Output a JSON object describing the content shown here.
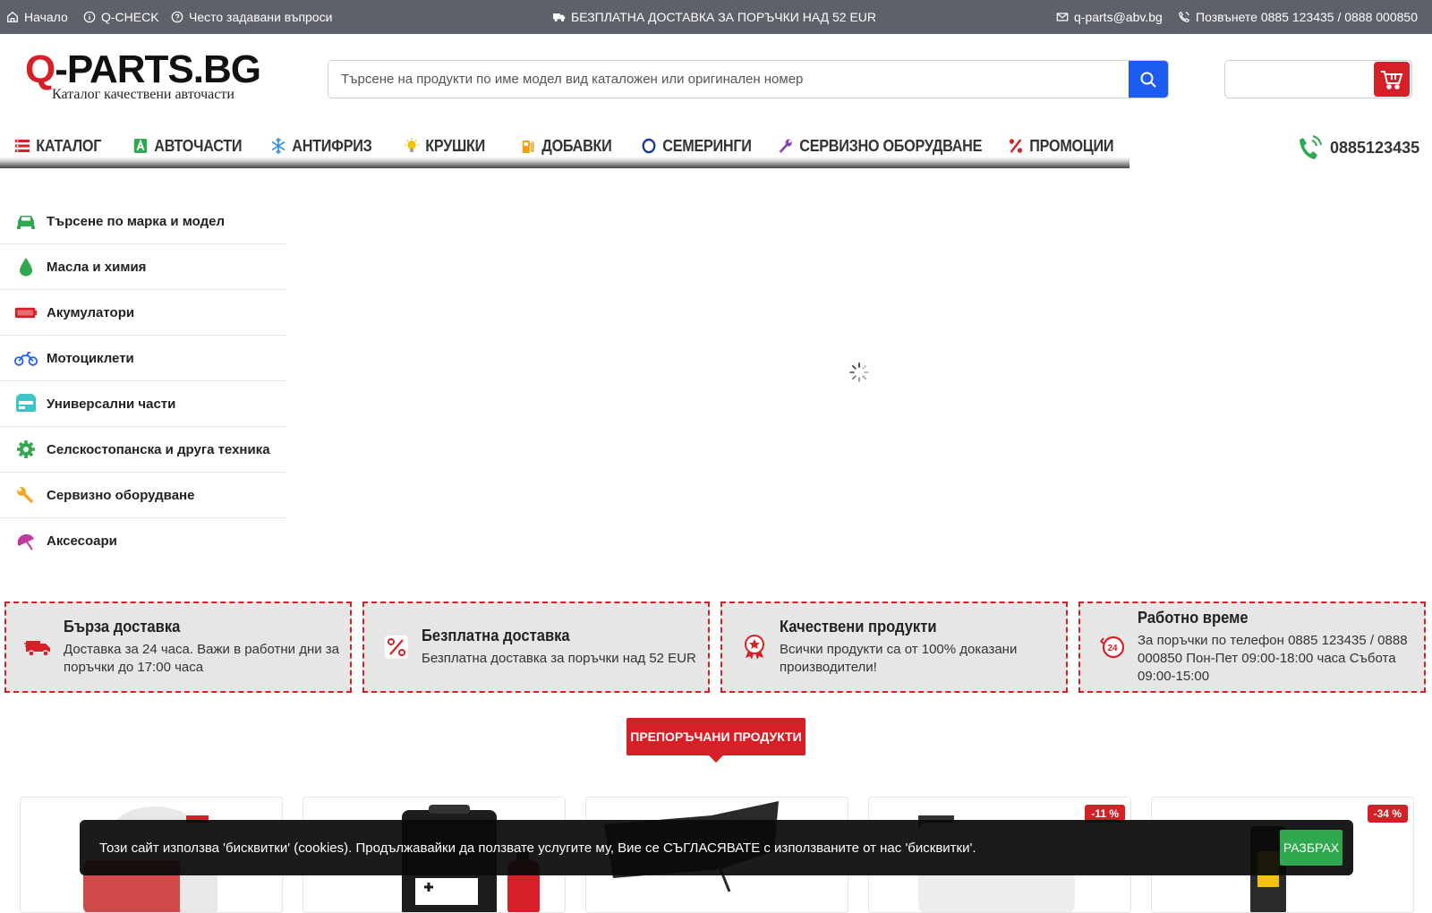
{
  "topbar": {
    "home": "Начало",
    "qcheck": "Q-CHECK",
    "faq": "Често задавани въпроси",
    "free_shipping": "БЕЗПЛАТНА ДОСТАВКА ЗА ПОРЪЧКИ НАД 52 EUR",
    "email": "q-parts@abv.bg",
    "phone": "Позвънете 0885 123435 / 0888 000850"
  },
  "logo": {
    "main_q": "Q",
    "main_rest": "-PARTS.BG",
    "tagline": "Каталог качествени авточасти"
  },
  "search": {
    "placeholder": "Търсене на продукти по име модел вид каталожен или оригинален номер"
  },
  "nav": {
    "items": [
      {
        "label": "КАТАЛОГ",
        "icon": "catalog-icon"
      },
      {
        "label": "АВТОЧАСТИ",
        "icon": "autoparts-icon"
      },
      {
        "label": "АНТИФРИЗ",
        "icon": "snowflake-icon"
      },
      {
        "label": "КРУШКИ",
        "icon": "bulb-icon"
      },
      {
        "label": "ДОБАВКИ",
        "icon": "fuel-icon"
      },
      {
        "label": "СЕМЕРИНГИ",
        "icon": "ring-icon"
      },
      {
        "label": "СЕРВИЗНО ОБОРУДВАНЕ",
        "icon": "wrench-icon"
      },
      {
        "label": "ПРОМОЦИИ",
        "icon": "percent-icon"
      }
    ],
    "phone": "0885123435"
  },
  "sidebar": {
    "items": [
      {
        "label": "Търсене по марка и модел",
        "icon": "car-icon"
      },
      {
        "label": "Масла и химия",
        "icon": "oil-drop-icon"
      },
      {
        "label": "Акумулатори",
        "icon": "battery-icon"
      },
      {
        "label": "Мотоциклети",
        "icon": "motorcycle-icon"
      },
      {
        "label": "Универсални части",
        "icon": "universal-parts-icon"
      },
      {
        "label": "Селскостопанска и друга техника",
        "icon": "gear-icon"
      },
      {
        "label": "Сервизно оборудване",
        "icon": "wrench-icon"
      },
      {
        "label": "Аксесоари",
        "icon": "umbrella-icon"
      }
    ]
  },
  "features": [
    {
      "title": "Бърза доставка",
      "text": "Доставка за 24 часа. Важи в работни дни за поръчки до 17:00 часа",
      "icon": "truck-icon"
    },
    {
      "title": "Безплатна доставка",
      "text": "Безплатна доставка за поръчки над 52 EUR",
      "icon": "percent-tag-icon"
    },
    {
      "title": "Качествени продукти",
      "text": "Всички продукти са от 100% доказани производители!",
      "icon": "quality-badge-icon"
    },
    {
      "title": "Работно време",
      "text": "За поръчки по телефон 0885 123435 / 0888 000850 Пон-Пет 09:00-18:00 часа Събота 09:00-15:00",
      "icon": "clock-24-icon"
    }
  ],
  "recommended": {
    "label": "ПРЕПОРЪЧАНИ ПРОДУКТИ"
  },
  "products": [
    {
      "badge": ""
    },
    {
      "badge": ""
    },
    {
      "badge": ""
    },
    {
      "badge": "-11 %"
    },
    {
      "badge": "-34 %"
    }
  ],
  "cookie": {
    "text": "Този сайт използва 'бисквитки' (cookies). Продължавайки да ползвате услугите му, Вие се СЪГЛАСЯВАТЕ с използваните от нас 'бисквитки'.",
    "button": "РАЗБРАХ"
  },
  "colors": {
    "brand_red": "#d61f26",
    "search_blue": "#1d5cf0",
    "topbar_gray": "#5e6169",
    "accept_green": "#2fa84f"
  }
}
